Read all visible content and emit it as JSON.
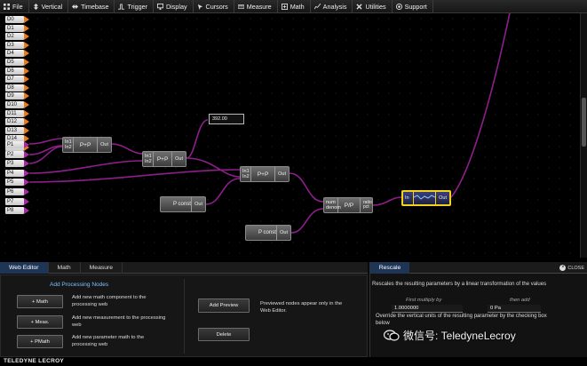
{
  "menu": [
    {
      "label": "File",
      "icon": "grid-icon"
    },
    {
      "label": "Vertical",
      "icon": "vertical-arrows-icon"
    },
    {
      "label": "Timebase",
      "icon": "horizontal-arrows-icon"
    },
    {
      "label": "Trigger",
      "icon": "trigger-icon"
    },
    {
      "label": "Display",
      "icon": "monitor-icon"
    },
    {
      "label": "Cursors",
      "icon": "cursor-icon"
    },
    {
      "label": "Measure",
      "icon": "ruler-icon"
    },
    {
      "label": "Math",
      "icon": "math-icon"
    },
    {
      "label": "Analysis",
      "icon": "analysis-icon"
    },
    {
      "label": "Utilities",
      "icon": "tools-icon"
    },
    {
      "label": "Support",
      "icon": "support-icon"
    }
  ],
  "digital_channels": [
    "D0",
    "D1",
    "D2",
    "D3",
    "D4",
    "D5",
    "D6",
    "D7",
    "D8",
    "D9",
    "D10",
    "D11",
    "D12",
    "D13",
    "D14",
    "D15"
  ],
  "parameter_channels": [
    "P1",
    "P2",
    "P3",
    "P4",
    "P5",
    "P6",
    "P7",
    "P8"
  ],
  "nodes": {
    "sum1": {
      "in1": "In1",
      "in2": "In2",
      "label": "P+P",
      "out": "Out"
    },
    "sum2": {
      "in1": "In1",
      "in2": "In2",
      "label": "P+P",
      "out": "Out"
    },
    "sum3": {
      "in1": "In1",
      "in2": "In2",
      "label": "P+P",
      "out": "Out"
    },
    "readout": "392.00",
    "const1": {
      "label": "P const",
      "out": "Out"
    },
    "const2": {
      "label": "P const",
      "out": "Out"
    },
    "ratio": {
      "in1": "num",
      "in2": "denom",
      "label": "P/P",
      "out": "ratio pct"
    },
    "selected": {
      "in": "In",
      "label": "",
      "out": "Out"
    }
  },
  "colors": {
    "digital": "#e87b1a",
    "parameter": "#a42ba0",
    "wire": "#8e1f8a",
    "selected": "#f2d21a",
    "accent": "#1f3556"
  },
  "tabs": [
    "Web Editor",
    "Math",
    "Measure"
  ],
  "editor": {
    "title": "Add Processing Nodes",
    "buttons": [
      {
        "label": "+ Math",
        "desc": "Add new math component to the processing web"
      },
      {
        "label": "+ Meas.",
        "desc": "Add new measurement to the processing web"
      },
      {
        "label": "+ PMath",
        "desc": "Add new parameter math to the processing web"
      }
    ],
    "add_preview": "Add Preview",
    "preview_desc": "Previewed nodes appear only in the Web Editor.",
    "delete": "Delete"
  },
  "rescale": {
    "tab": "Rescale",
    "close": "CLOSE",
    "desc": "Rescales the resulting parameters by a linear transformation of the values",
    "first_label": "First multiply by",
    "first_value": "1.0000000",
    "then_label": "then add",
    "then_value": "0 Pa",
    "override": "Override the vertical units of the resulting parameter by the checking box below"
  },
  "watermark": "微信号: TeledyneLecroy",
  "footer": "TELEDYNE LECROY"
}
